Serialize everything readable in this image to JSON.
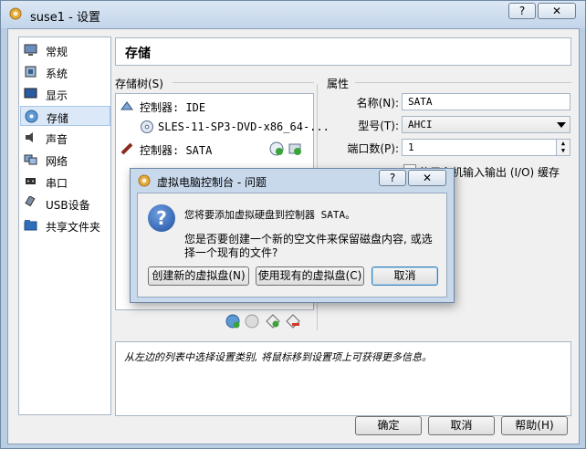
{
  "window": {
    "title": "suse1 - 设置",
    "help_glyph": "?",
    "close_glyph": "✕"
  },
  "sidebar": {
    "items": [
      {
        "label": "常规",
        "icon": "general-icon"
      },
      {
        "label": "系统",
        "icon": "system-icon"
      },
      {
        "label": "显示",
        "icon": "display-icon"
      },
      {
        "label": "存储",
        "icon": "storage-icon",
        "active": true
      },
      {
        "label": "声音",
        "icon": "audio-icon"
      },
      {
        "label": "网络",
        "icon": "network-icon"
      },
      {
        "label": "串口",
        "icon": "serial-port-icon"
      },
      {
        "label": "USB设备",
        "icon": "usb-icon"
      },
      {
        "label": "共享文件夹",
        "icon": "shared-folder-icon"
      }
    ]
  },
  "page": {
    "title": "存储",
    "tree_label": "存储树(S)",
    "props_label": "属性"
  },
  "tree": {
    "controller_ide": "控制器: IDE",
    "disk_ide": "SLES-11-SP3-DVD-x86_64-...",
    "controller_sata": "控制器: SATA"
  },
  "props": {
    "name_label": "名称(N):",
    "name_value": "SATA",
    "type_label": "型号(T):",
    "type_value": "AHCI",
    "ports_label": "端口数(P):",
    "ports_value": "1",
    "cache_label": "使用主机输入输出 (I/O) 缓存"
  },
  "info": {
    "text": "从左边的列表中选择设置类别, 将鼠标移到设置项上可获得更多信息。"
  },
  "buttons": {
    "ok": "确定",
    "cancel": "取消",
    "help": "帮助(H)"
  },
  "dialog": {
    "title": "虚拟电脑控制台 - 问题",
    "help_glyph": "?",
    "close_glyph": "✕",
    "question_glyph": "?",
    "line1": "您将要添加虚拟硬盘到控制器 SATA。",
    "line2": "您是否要创建一个新的空文件来保留磁盘内容, 或选",
    "line3": "择一个现有的文件?",
    "create_new": "创建新的虚拟盘(N)",
    "use_existing": "使用现有的虚拟盘(C)",
    "cancel": "取消"
  },
  "colors": {
    "accent": "#2f63b5",
    "question_badge": "#1f4fa0"
  }
}
